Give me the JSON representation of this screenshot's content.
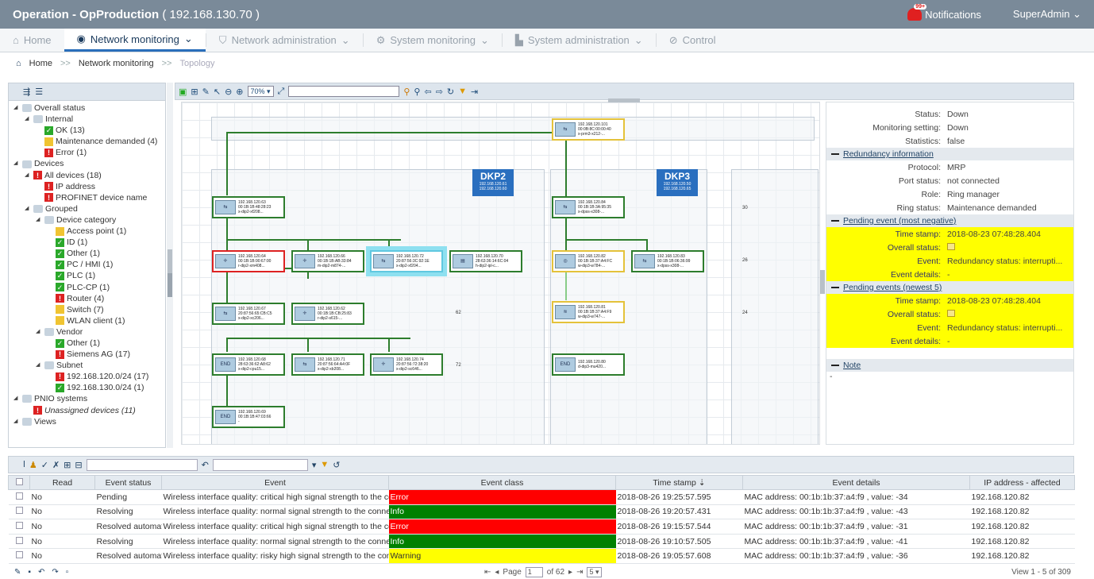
{
  "header": {
    "title": "Operation - OpProduction",
    "ip": "( 192.168.130.70 )",
    "notif_badge": "99+",
    "notifications": "Notifications",
    "user": "SuperAdmin"
  },
  "nav": {
    "home": "Home",
    "network_monitoring": "Network monitoring",
    "network_administration": "Network administration",
    "system_monitoring": "System monitoring",
    "system_administration": "System administration",
    "control": "Control"
  },
  "breadcrumb": {
    "home": "Home",
    "sep": ">>",
    "network_monitoring": "Network monitoring",
    "topology": "Topology"
  },
  "tree": [
    {
      "d": 0,
      "tri": "◢",
      "icon": "fold",
      "text": "Overall status"
    },
    {
      "d": 1,
      "tri": "◢",
      "icon": "fold",
      "text": "Internal"
    },
    {
      "d": 2,
      "icon": "g",
      "text": "OK (13)"
    },
    {
      "d": 2,
      "icon": "y",
      "text": "Maintenance demanded (4)"
    },
    {
      "d": 2,
      "icon": "r",
      "text": "Error (1)"
    },
    {
      "d": 0,
      "tri": "◢",
      "icon": "fold",
      "text": "Devices"
    },
    {
      "d": 1,
      "tri": "◢",
      "icon": "r",
      "text": "All devices (18)"
    },
    {
      "d": 2,
      "icon": "r",
      "text": "IP address"
    },
    {
      "d": 2,
      "icon": "r",
      "text": "PROFINET device name"
    },
    {
      "d": 1,
      "tri": "◢",
      "icon": "fold",
      "text": "Grouped"
    },
    {
      "d": 2,
      "tri": "◢",
      "icon": "fold",
      "text": "Device category"
    },
    {
      "d": 3,
      "icon": "y",
      "text": "Access point (1)"
    },
    {
      "d": 3,
      "icon": "g",
      "text": "ID (1)"
    },
    {
      "d": 3,
      "icon": "g",
      "text": "Other (1)"
    },
    {
      "d": 3,
      "icon": "g",
      "text": "PC / HMI (1)"
    },
    {
      "d": 3,
      "icon": "g",
      "text": "PLC (1)"
    },
    {
      "d": 3,
      "icon": "g",
      "text": "PLC-CP (1)"
    },
    {
      "d": 3,
      "icon": "r",
      "text": "Router (4)"
    },
    {
      "d": 3,
      "icon": "y",
      "text": "Switch (7)"
    },
    {
      "d": 3,
      "icon": "y",
      "text": "WLAN client (1)"
    },
    {
      "d": 2,
      "tri": "◢",
      "icon": "fold",
      "text": "Vendor"
    },
    {
      "d": 3,
      "icon": "g",
      "text": "Other (1)"
    },
    {
      "d": 3,
      "icon": "r",
      "text": "Siemens AG (17)"
    },
    {
      "d": 2,
      "tri": "◢",
      "icon": "fold",
      "text": "Subnet"
    },
    {
      "d": 3,
      "icon": "r",
      "text": "192.168.120.0/24 (17)"
    },
    {
      "d": 3,
      "icon": "g",
      "text": "192.168.130.0/24 (1)"
    },
    {
      "d": 0,
      "tri": "◢",
      "icon": "fold",
      "text": "PNIO systems"
    },
    {
      "d": 1,
      "icon": "r",
      "text": "Unassigned devices (11)",
      "italic": true
    },
    {
      "d": 0,
      "tri": "◢",
      "icon": "fold",
      "text": "Views"
    }
  ],
  "topology_toolbar": {
    "zoom": "70%"
  },
  "topology": {
    "dkp2": {
      "label": "DKP2",
      "sub1": "192.168.120.61",
      "sub2": "192.168.120.60"
    },
    "dkp3": {
      "label": "DKP3",
      "sub1": "192.168.120.50",
      "sub2": "192.168.120.65"
    },
    "row_labels": [
      "30",
      "26",
      "62",
      "24",
      "72"
    ],
    "nodes": [
      {
        "id": "n101",
        "ic": "⇆",
        "l1": "192.168.120.101",
        "l2": "00:0B:8C:00:00:40",
        "l3": "x-prm3-x212-..."
      },
      {
        "id": "n63",
        "ic": "⇆",
        "l1": "192.168.120.63",
        "l2": "00:1B:1B:48:28:23",
        "l3": "x-dip2-xf208..."
      },
      {
        "id": "n84",
        "ic": "⇆",
        "l1": "192.168.120.84",
        "l2": "00:1B:1B:3A:95:35",
        "l3": "x-dpss-x308-..."
      },
      {
        "id": "n64",
        "ic": "✛",
        "l1": "192.168.120.64",
        "l2": "00:1B:1B:90:67:00",
        "l3": "r-dip2-xm408..."
      },
      {
        "id": "n66",
        "ic": "✛",
        "l1": "192.168.120.66",
        "l2": "00:1B:1B:AB:33:84",
        "l3": "m-dip2-m874-..."
      },
      {
        "id": "n72",
        "ic": "⇆",
        "l1": "192.168.120.72",
        "l2": "20:87:56:3C:92:1E",
        "l3": "x-dip2-xf204..."
      },
      {
        "id": "n70",
        "ic": "▤",
        "l1": "192.168.120.70",
        "l2": "28:63:36:14:6C:04",
        "l3": "h-dip2-ipl-c..."
      },
      {
        "id": "n82",
        "ic": "◎",
        "l1": "192.168.120.82",
        "l2": "00:1B:1B:37:A4:FC",
        "l3": "w-dip3-w784-..."
      },
      {
        "id": "n83",
        "ic": "⇆",
        "l1": "192.168.120.83",
        "l2": "00:1B:1B:06:36:99",
        "l3": "x-dpss-x308-..."
      },
      {
        "id": "n67",
        "ic": "⇆",
        "l1": "192.168.120.67",
        "l2": "20:87:56:65:CB:C5",
        "l3": "x-dip2-xc206..."
      },
      {
        "id": "n62",
        "ic": "✛",
        "l1": "192.168.120.62",
        "l2": "00:1B:1B:CB:25:83",
        "l3": "r-dip2-s615-..."
      },
      {
        "id": "n81",
        "ic": "≋",
        "l1": "192.168.120.81",
        "l2": "00:1B:1B:37:A4:F9",
        "l3": "w-dip3-w747-..."
      },
      {
        "id": "n68",
        "ic": "END",
        "l1": "192.168.120.68",
        "l2": "28:63:36:62:A8:62",
        "l3": "x-dip2-cpu15..."
      },
      {
        "id": "n71",
        "ic": "⇆",
        "l1": "192.168.120.71",
        "l2": "20:87:56:64:A4:0F",
        "l3": "x-dip2-xb208..."
      },
      {
        "id": "n74",
        "ic": "✛",
        "l1": "192.168.120.74",
        "l2": "20:87:56:72:38:20",
        "l3": "x-dip2-sc646..."
      },
      {
        "id": "n80",
        "ic": "END",
        "l1": "192.168.120.80",
        "l2": "",
        "l3": "d-dip3-mu420..."
      },
      {
        "id": "n69",
        "ic": "END",
        "l1": "192.168.120.69",
        "l2": "00:1B:1B:47:03:66",
        "l3": "-"
      }
    ]
  },
  "details": {
    "top": [
      {
        "k": "Status:",
        "v": "Down"
      },
      {
        "k": "Monitoring setting:",
        "v": "Down"
      },
      {
        "k": "Statistics:",
        "v": "false"
      }
    ],
    "redundancy_title": "Redundancy information",
    "redundancy": [
      {
        "k": "Protocol:",
        "v": "MRP"
      },
      {
        "k": "Port status:",
        "v": "not connected"
      },
      {
        "k": "Role:",
        "v": "Ring manager"
      },
      {
        "k": "Ring status:",
        "v": "Maintenance demanded"
      }
    ],
    "pending_title": "Pending event (most negative)",
    "pending": {
      "ts_k": "Time stamp:",
      "ts_v": "2018-08-23 07:48:28.404",
      "os_k": "Overall status:",
      "ev_k": "Event:",
      "ev_v": "Redundancy status: interrupti...",
      "ed_k": "Event details:",
      "ed_v": "-"
    },
    "pending5_title": "Pending events (newest 5)",
    "pending5": {
      "ts_k": "Time stamp:",
      "ts_v": "2018-08-23 07:48:28.404",
      "os_k": "Overall status:",
      "ev_k": "Event:",
      "ev_v": "Redundancy status: interrupti...",
      "ed_k": "Event details:",
      "ed_v": "-"
    },
    "note_title": "Note",
    "note_v": "-"
  },
  "events": {
    "columns": [
      "Read",
      "Event status",
      "Event",
      "Event class",
      "Time stamp ⇣",
      "Event details",
      "IP address - affected"
    ],
    "rows": [
      {
        "read": "No",
        "status": "Pending",
        "event": "Wireless interface quality: critical high signal strength to the conn",
        "cls": "Error",
        "clscolor": "#ff0000",
        "time": "2018-08-26 19:25:57.595",
        "details": "MAC address: 00:1b:1b:37:a4:f9 , value: -34",
        "ip": "192.168.120.82"
      },
      {
        "read": "No",
        "status": "Resolving",
        "event": "Wireless interface quality: normal signal strength to the connected",
        "cls": "Info",
        "clscolor": "#008000",
        "time": "2018-08-26 19:20:57.431",
        "details": "MAC address: 00:1b:1b:37:a4:f9 , value: -43",
        "ip": "192.168.120.82"
      },
      {
        "read": "No",
        "status": "Resolved automat",
        "event": "Wireless interface quality: critical high signal strength to the conn",
        "cls": "Error",
        "clscolor": "#ff0000",
        "time": "2018-08-26 19:15:57.544",
        "details": "MAC address: 00:1b:1b:37:a4:f9 , value: -31",
        "ip": "192.168.120.82"
      },
      {
        "read": "No",
        "status": "Resolving",
        "event": "Wireless interface quality: normal signal strength to the connected",
        "cls": "Info",
        "clscolor": "#008000",
        "time": "2018-08-26 19:10:57.505",
        "details": "MAC address: 00:1b:1b:37:a4:f9 , value: -41",
        "ip": "192.168.120.82"
      },
      {
        "read": "No",
        "status": "Resolved automat",
        "event": "Wireless interface quality: risky high signal strength to the conn",
        "cls": "Warning",
        "clscolor": "#ffff00",
        "time": "2018-08-26 19:05:57.608",
        "details": "MAC address: 00:1b:1b:37:a4:f9 , value: -36",
        "ip": "192.168.120.82"
      }
    ]
  },
  "pager": {
    "page_label": "Page",
    "page": "1",
    "of": "of 62",
    "per_page": "5",
    "view": "View 1 - 5 of 309"
  }
}
